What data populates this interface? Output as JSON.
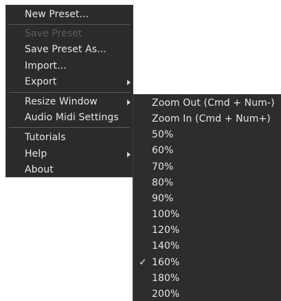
{
  "main_menu": {
    "items": [
      {
        "label": "New Preset..."
      },
      {
        "label": "Save Preset"
      },
      {
        "label": "Save Preset As..."
      },
      {
        "label": "Import..."
      },
      {
        "label": "Export"
      },
      {
        "label": "Resize Window"
      },
      {
        "label": "Audio Midi Settings"
      },
      {
        "label": "Tutorials"
      },
      {
        "label": "Help"
      },
      {
        "label": "About"
      }
    ]
  },
  "resize_submenu": {
    "items": [
      {
        "label": "Zoom Out (Cmd + Num-)"
      },
      {
        "label": "Zoom In (Cmd + Num+)"
      },
      {
        "label": "50%"
      },
      {
        "label": "60%"
      },
      {
        "label": "70%"
      },
      {
        "label": "80%"
      },
      {
        "label": "90%"
      },
      {
        "label": "100%"
      },
      {
        "label": "120%"
      },
      {
        "label": "140%"
      },
      {
        "label": "160%"
      },
      {
        "label": "180%"
      },
      {
        "label": "200%"
      }
    ],
    "checkmark": "✓"
  }
}
